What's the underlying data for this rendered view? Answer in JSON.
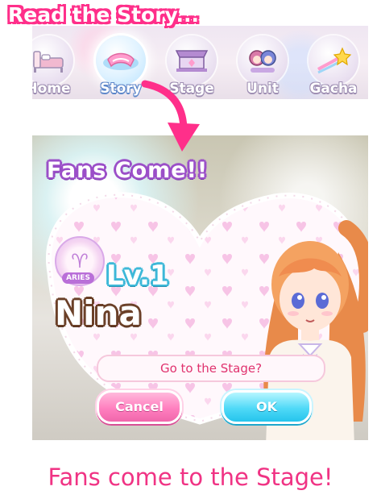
{
  "captions": {
    "top": "Read the Story...",
    "bottom": "Fans come to the Stage!"
  },
  "nav": {
    "items": [
      {
        "label": "Home",
        "icon": "bed-icon",
        "active": false
      },
      {
        "label": "Story",
        "icon": "story-book-icon",
        "active": true
      },
      {
        "label": "Stage",
        "icon": "stage-icon",
        "active": false
      },
      {
        "label": "Unit",
        "icon": "unit-icon",
        "active": false
      },
      {
        "label": "Gacha",
        "icon": "star-icon",
        "active": false
      }
    ]
  },
  "popup": {
    "title": "Fans Come!!",
    "badge_label": "ARIES",
    "level": "Lv.1",
    "character_name": "Nina",
    "question": "Go to the Stage?",
    "cancel_label": "Cancel",
    "ok_label": "OK"
  },
  "colors": {
    "accent_pink": "#ff2f8a",
    "cancel_button": "#ff7fbf",
    "ok_button": "#25c4ec",
    "caption_text": "#f03384"
  }
}
